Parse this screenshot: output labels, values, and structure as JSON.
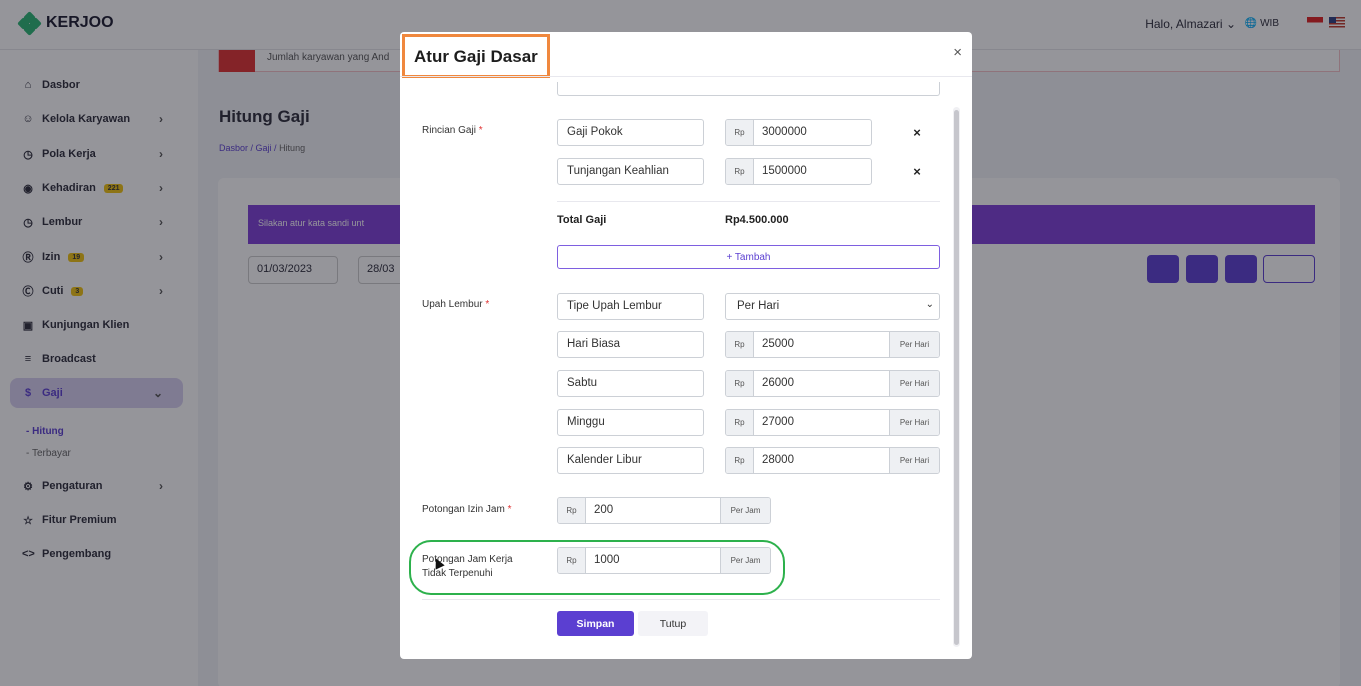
{
  "app": {
    "logo": "KERJOO"
  },
  "topbar": {
    "greeting_prefix": "Halo,",
    "user": "Almazari",
    "user_chevron": "⌄",
    "timezone": "WIB",
    "lang_icons": [
      "flag-id-icon",
      "flag-us-icon"
    ]
  },
  "sidebar": {
    "items": [
      {
        "label": "Dasbor",
        "icon": "home-icon",
        "glyph": "⌂"
      },
      {
        "label": "Kelola Karyawan",
        "icon": "users-icon",
        "glyph": "☺"
      },
      {
        "label": "Pola Kerja",
        "icon": "clock-icon",
        "glyph": "◷"
      },
      {
        "label": "Kehadiran",
        "icon": "location-icon",
        "glyph": "◉",
        "badge": "221"
      },
      {
        "label": "Lembur",
        "icon": "clock-icon",
        "glyph": "◷"
      },
      {
        "label": "Izin",
        "icon": "permit-icon",
        "glyph": "Ⓡ",
        "badge": "19"
      },
      {
        "label": "Cuti",
        "icon": "leave-icon",
        "glyph": "Ⓒ",
        "badge": "3"
      },
      {
        "label": "Kunjungan Klien",
        "icon": "briefcase-icon",
        "glyph": "▣"
      },
      {
        "label": "Broadcast",
        "icon": "rss-icon",
        "glyph": "≡"
      },
      {
        "label": "Gaji",
        "icon": "dollar-icon",
        "glyph": "$"
      },
      {
        "label": "Pengaturan",
        "icon": "gear-icon",
        "glyph": "⚙"
      },
      {
        "label": "Fitur Premium",
        "icon": "star-icon",
        "glyph": "☆"
      },
      {
        "label": "Pengembang",
        "icon": "code-icon",
        "glyph": "<>"
      }
    ],
    "sub_items": [
      "Hitung",
      "Terbayar"
    ]
  },
  "page": {
    "alert": "Jumlah karyawan yang And",
    "title": "Hitung Gaji",
    "breadcrumb": [
      "Dasbor",
      "Gaji",
      "Hitung"
    ],
    "banner": "Silakan atur kata sandi unt",
    "date_from": "01/03/2023",
    "date_to": "28/03"
  },
  "modal": {
    "title": "Atur Gaji Dasar",
    "close": "×",
    "rincian": {
      "label": "Rincian Gaji",
      "rows": [
        {
          "name": "Gaji Pokok",
          "currency": "Rp",
          "value": "3000000"
        },
        {
          "name": "Tunjangan Keahlian",
          "currency": "Rp",
          "value": "1500000"
        }
      ],
      "remove": "×",
      "total_label": "Total Gaji",
      "total_value": "Rp4.500.000",
      "add_label": "+ Tambah"
    },
    "lembur": {
      "label": "Upah Lembur",
      "type_label": "Tipe Upah Lembur",
      "type_value": "Per Hari",
      "rows": [
        {
          "name": "Hari Biasa",
          "currency": "Rp",
          "value": "25000",
          "unit": "Per Hari"
        },
        {
          "name": "Sabtu",
          "currency": "Rp",
          "value": "26000",
          "unit": "Per Hari"
        },
        {
          "name": "Minggu",
          "currency": "Rp",
          "value": "27000",
          "unit": "Per Hari"
        },
        {
          "name": "Kalender Libur",
          "currency": "Rp",
          "value": "28000",
          "unit": "Per Hari"
        }
      ]
    },
    "potongan_izin": {
      "label": "Potongan Izin Jam",
      "currency": "Rp",
      "value": "200",
      "unit": "Per Jam"
    },
    "potongan_jam": {
      "label": "Potongan Jam Kerja Tidak Terpenuhi",
      "currency": "Rp",
      "value": "1000",
      "unit": "Per Jam"
    },
    "save": "Simpan",
    "cancel": "Tutup"
  }
}
